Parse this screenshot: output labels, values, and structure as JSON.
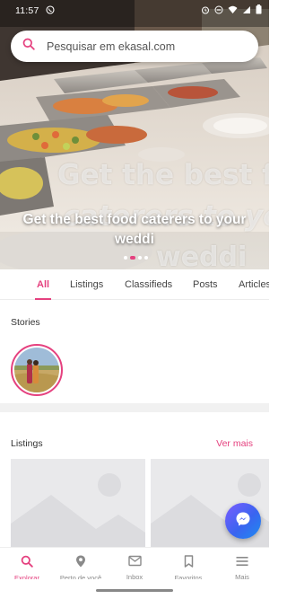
{
  "status_bar": {
    "time": "11:57"
  },
  "search": {
    "placeholder": "Pesquisar em ekasal.com"
  },
  "hero": {
    "title": "Get the best food caterers to your weddi",
    "overlay_lines": [
      "Get the best fo",
      "caterers to yo",
      "weddi"
    ],
    "slide_count": 4,
    "active_slide": 2
  },
  "tabs": [
    {
      "label": "All",
      "active": true
    },
    {
      "label": "Listings",
      "active": false
    },
    {
      "label": "Classifieds",
      "active": false
    },
    {
      "label": "Posts",
      "active": false
    },
    {
      "label": "Articles",
      "active": false
    }
  ],
  "stories": {
    "title": "Stories"
  },
  "listings": {
    "title": "Listings",
    "see_more": "Ver mais"
  },
  "bottom_nav": [
    {
      "label": "Explorar",
      "icon": "search-icon",
      "active": true
    },
    {
      "label": "Perto de você",
      "icon": "location-pin-icon",
      "active": false
    },
    {
      "label": "Inbox",
      "icon": "mail-icon",
      "active": false
    },
    {
      "label": "Favoritos",
      "icon": "bookmark-icon",
      "active": false
    },
    {
      "label": "Mais",
      "icon": "menu-icon",
      "active": false
    }
  ],
  "colors": {
    "accent": "#e5417f",
    "fab_start": "#7b5cff",
    "fab_end": "#1d8cf0"
  }
}
